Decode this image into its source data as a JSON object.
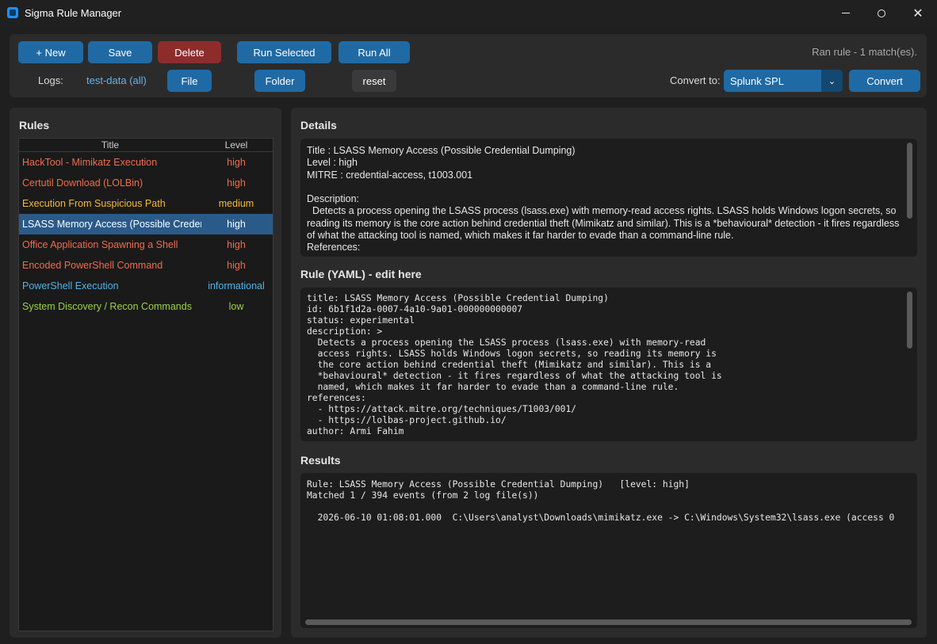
{
  "window": {
    "title": "Sigma Rule Manager",
    "minimize": "",
    "maximize": "",
    "close": "✕"
  },
  "toolbar": {
    "new_label": "+ New",
    "save_label": "Save",
    "delete_label": "Delete",
    "run_selected_label": "Run Selected",
    "run_all_label": "Run All",
    "status": "Ran rule - 1 match(es).",
    "logs_label": "Logs:",
    "logs_value": "test-data (all)",
    "file_label": "File",
    "folder_label": "Folder",
    "reset_label": "reset",
    "convert_to_label": "Convert to:",
    "convert_target": "Splunk SPL",
    "convert_label": "Convert"
  },
  "rules": {
    "heading": "Rules",
    "col_title": "Title",
    "col_level": "Level",
    "items": [
      {
        "title": "HackTool - Mimikatz Execution",
        "level": "high",
        "color": "#f26b4f"
      },
      {
        "title": "Certutil Download (LOLBin)",
        "level": "high",
        "color": "#f26b4f"
      },
      {
        "title": "Execution From Suspicious Path",
        "level": "medium",
        "color": "#f5b93a"
      },
      {
        "title": "LSASS Memory Access (Possible Credential Dumping)",
        "level": "high",
        "color": "#f26b4f",
        "selected": true
      },
      {
        "title": "Office Application Spawning a Shell",
        "level": "high",
        "color": "#f26b4f"
      },
      {
        "title": "Encoded PowerShell Command",
        "level": "high",
        "color": "#f26b4f"
      },
      {
        "title": "PowerShell Execution",
        "level": "informational",
        "color": "#4fb3ea"
      },
      {
        "title": "System Discovery / Recon Commands",
        "level": "low",
        "color": "#9bd14a"
      }
    ]
  },
  "details": {
    "heading": "Details",
    "text": "Title : LSASS Memory Access (Possible Credential Dumping)\nLevel : high\nMITRE : credential-access, t1003.001\n\nDescription:\n  Detects a process opening the LSASS process (lsass.exe) with memory-read access rights. LSASS holds Windows logon secrets, so reading its memory is the core action behind credential theft (Mimikatz and similar). This is a *behavioural* detection - it fires regardless of what the attacking tool is named, which makes it far harder to evade than a command-line rule.\nReferences:"
  },
  "yaml": {
    "heading": "Rule (YAML) - edit here",
    "text": "title: LSASS Memory Access (Possible Credential Dumping)\nid: 6b1f1d2a-0007-4a10-9a01-000000000007\nstatus: experimental\ndescription: >\n  Detects a process opening the LSASS process (lsass.exe) with memory-read\n  access rights. LSASS holds Windows logon secrets, so reading its memory is\n  the core action behind credential theft (Mimikatz and similar). This is a\n  *behavioural* detection - it fires regardless of what the attacking tool is\n  named, which makes it far harder to evade than a command-line rule.\nreferences:\n  - https://attack.mitre.org/techniques/T1003/001/\n  - https://lolbas-project.github.io/\nauthor: Armi Fahim"
  },
  "results": {
    "heading": "Results",
    "text": "Rule: LSASS Memory Access (Possible Credential Dumping)   [level: high]\nMatched 1 / 394 events (from 2 log file(s))\n\n  2026-06-10 01:08:01.000  C:\\Users\\analyst\\Downloads\\mimikatz.exe -> C:\\Windows\\System32\\lsass.exe (access 0"
  }
}
